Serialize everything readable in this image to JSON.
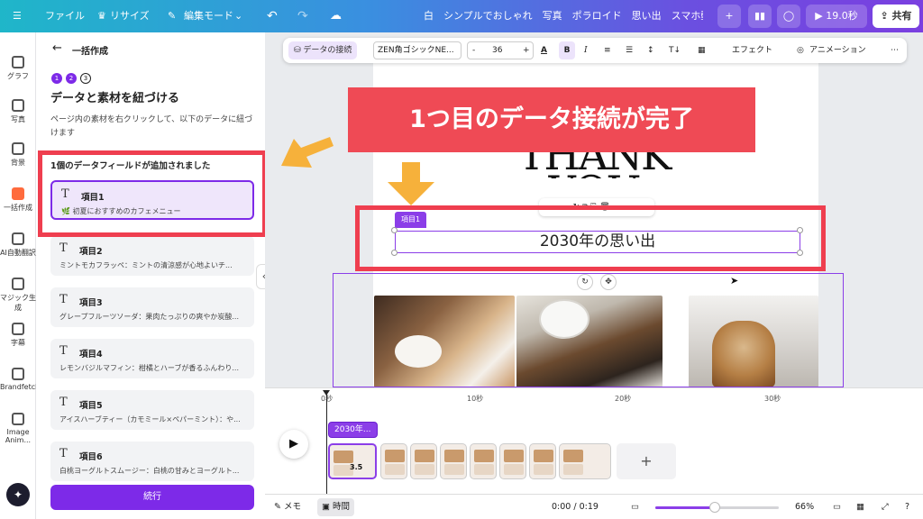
{
  "topbar": {
    "file": "ファイル",
    "resize": "リサイズ",
    "edit_mode": "編集モード",
    "doc_title": "白　シンプルでおしゃれ　写真　ポラロイド　思い出　スマホ動...",
    "play_duration": "19.0秒",
    "share": "共有"
  },
  "rail": [
    {
      "label": "グラフ",
      "icon": "chart-icon"
    },
    {
      "label": "写真",
      "icon": "photo-icon"
    },
    {
      "label": "背景",
      "icon": "background-icon"
    },
    {
      "label": "一括作成",
      "icon": "bulk-create-icon"
    },
    {
      "label": "AI自動翻訳",
      "icon": "translate-icon"
    },
    {
      "label": "マジック生成",
      "icon": "magic-icon"
    },
    {
      "label": "字幕",
      "icon": "caption-icon"
    },
    {
      "label": "Brandfetch",
      "icon": "brandfetch-icon"
    },
    {
      "label": "Image Anim...",
      "icon": "image-anim-icon"
    }
  ],
  "panel": {
    "header": "一括作成",
    "steps": [
      "1",
      "2",
      "3"
    ],
    "title": "データと素材を紐づける",
    "description": "ページ内の素材を右クリックして、以下のデータに紐づけます",
    "added_notice": "1個のデータフィールドが追加されました",
    "items": [
      {
        "name": "項目1",
        "value": "🌿 初夏におすすめのカフェメニュー"
      },
      {
        "name": "項目2",
        "value": "ミントモカフラッペ：ミントの清涼感が心地よいチ..."
      },
      {
        "name": "項目3",
        "value": "グレープフルーツソーダ：果肉たっぷりの爽やか炭酸..."
      },
      {
        "name": "項目4",
        "value": "レモンバジルマフィン：柑橘とハーブが香るふんわり..."
      },
      {
        "name": "項目5",
        "value": "アイスハーブティー（カモミール×ペパーミント）：や..."
      },
      {
        "name": "項目6",
        "value": "白桃ヨーグルトスムージー：白桃の甘みとヨーグルト..."
      }
    ],
    "continue": "続行"
  },
  "toolbar": {
    "data_link": "データの接続",
    "font": "ZEN角ゴシックNE...",
    "minus": "-",
    "font_size": "36",
    "plus": "+",
    "bold": "B",
    "italic": "I",
    "effects": "エフェクト",
    "animation": "アニメーション"
  },
  "canvas": {
    "banner": "1つ目のデータ接続が完了",
    "field_tag": "項目1",
    "text_value": "2030年の思い出",
    "heading_graphic": "THANK YOU"
  },
  "timeline": {
    "ticks": [
      "0秒",
      "10秒",
      "20秒",
      "30秒"
    ],
    "clip_label": "2030年...",
    "first_clip_duration": "3.5"
  },
  "bottom": {
    "memo": "メモ",
    "time": "時間",
    "time_readout": "0:00 / 0:19",
    "zoom": "66%",
    "zoom_fraction": 0.47
  },
  "colors": {
    "accent": "#7d2ae8",
    "highlight_red": "#ef3e4f",
    "arrow_orange": "#f6b13b"
  }
}
